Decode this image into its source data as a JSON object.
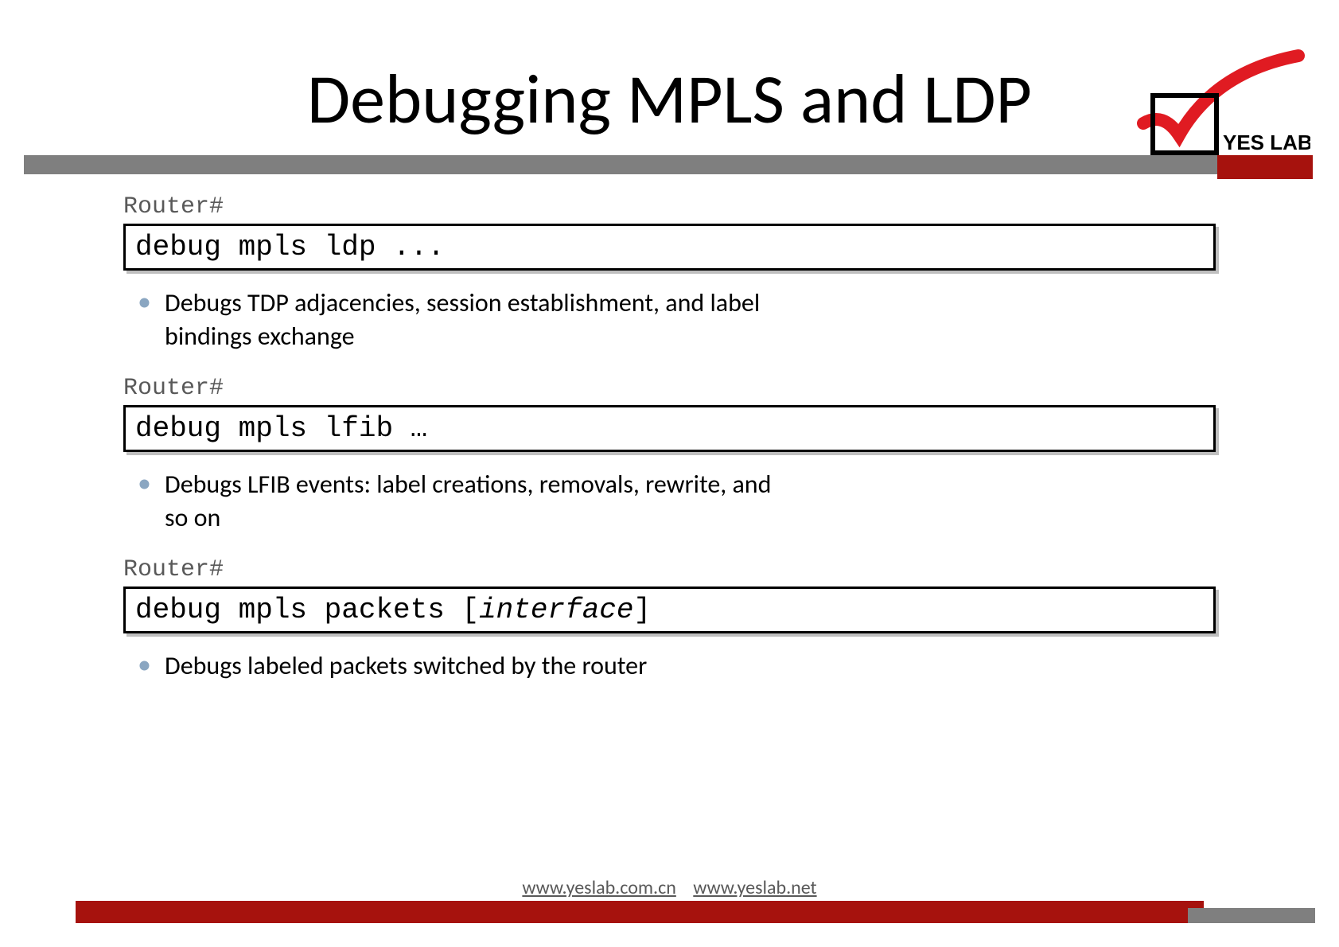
{
  "title": "Debugging MPLS and LDP",
  "logo_text": "YES LAB",
  "sections": [
    {
      "prompt": "Router#",
      "command": "debug mpls ldp ...",
      "bullet": "Debugs TDP adjacencies, session establishment, and label bindings exchange"
    },
    {
      "prompt": "Router#",
      "command": "debug mpls lfib …",
      "bullet": "Debugs LFIB events: label creations, removals, rewrite, and so on"
    },
    {
      "prompt": "Router#",
      "command_prefix": "debug mpls packets [",
      "command_italic": "interface",
      "command_suffix": "]",
      "bullet": "Debugs labeled packets switched by the router"
    }
  ],
  "footer": {
    "link1": "www.yeslab.com.cn",
    "link2": "www.yeslab.net"
  }
}
